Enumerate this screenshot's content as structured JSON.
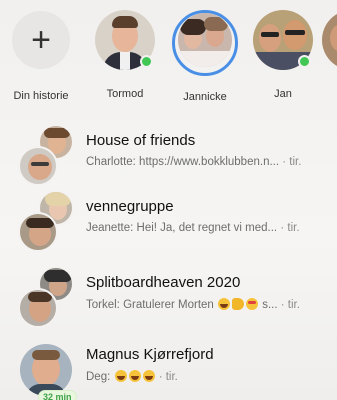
{
  "stories": [
    {
      "name": "Din historie",
      "type": "add",
      "icon": "plus-icon"
    },
    {
      "name": "Tormod",
      "online": true
    },
    {
      "name": "Jannicke",
      "has_story": true
    },
    {
      "name": "Jan",
      "online": true
    }
  ],
  "chats": [
    {
      "title": "House of friends",
      "preview": "Charlotte: https://www.bokklubben.n...",
      "time": "· tir.",
      "group": true
    },
    {
      "title": "vennegruppe",
      "preview": "Jeanette: Hei! Ja, det regnet vi med...",
      "time": "· tir.",
      "group": true
    },
    {
      "title": "Splitboardheaven 2020",
      "preview": "Torkel: Gratulerer Morten",
      "preview_tail": " s...",
      "time": "· tir.",
      "group": true
    },
    {
      "title": "Magnus Kjørrefjord",
      "preview": "Deg:",
      "time": "· tir.",
      "active_badge": "32 min",
      "group": false
    }
  ],
  "colors": {
    "online": "#40c754",
    "story_ring": "#4a8fe6",
    "active_badge_text": "#3fa348"
  }
}
